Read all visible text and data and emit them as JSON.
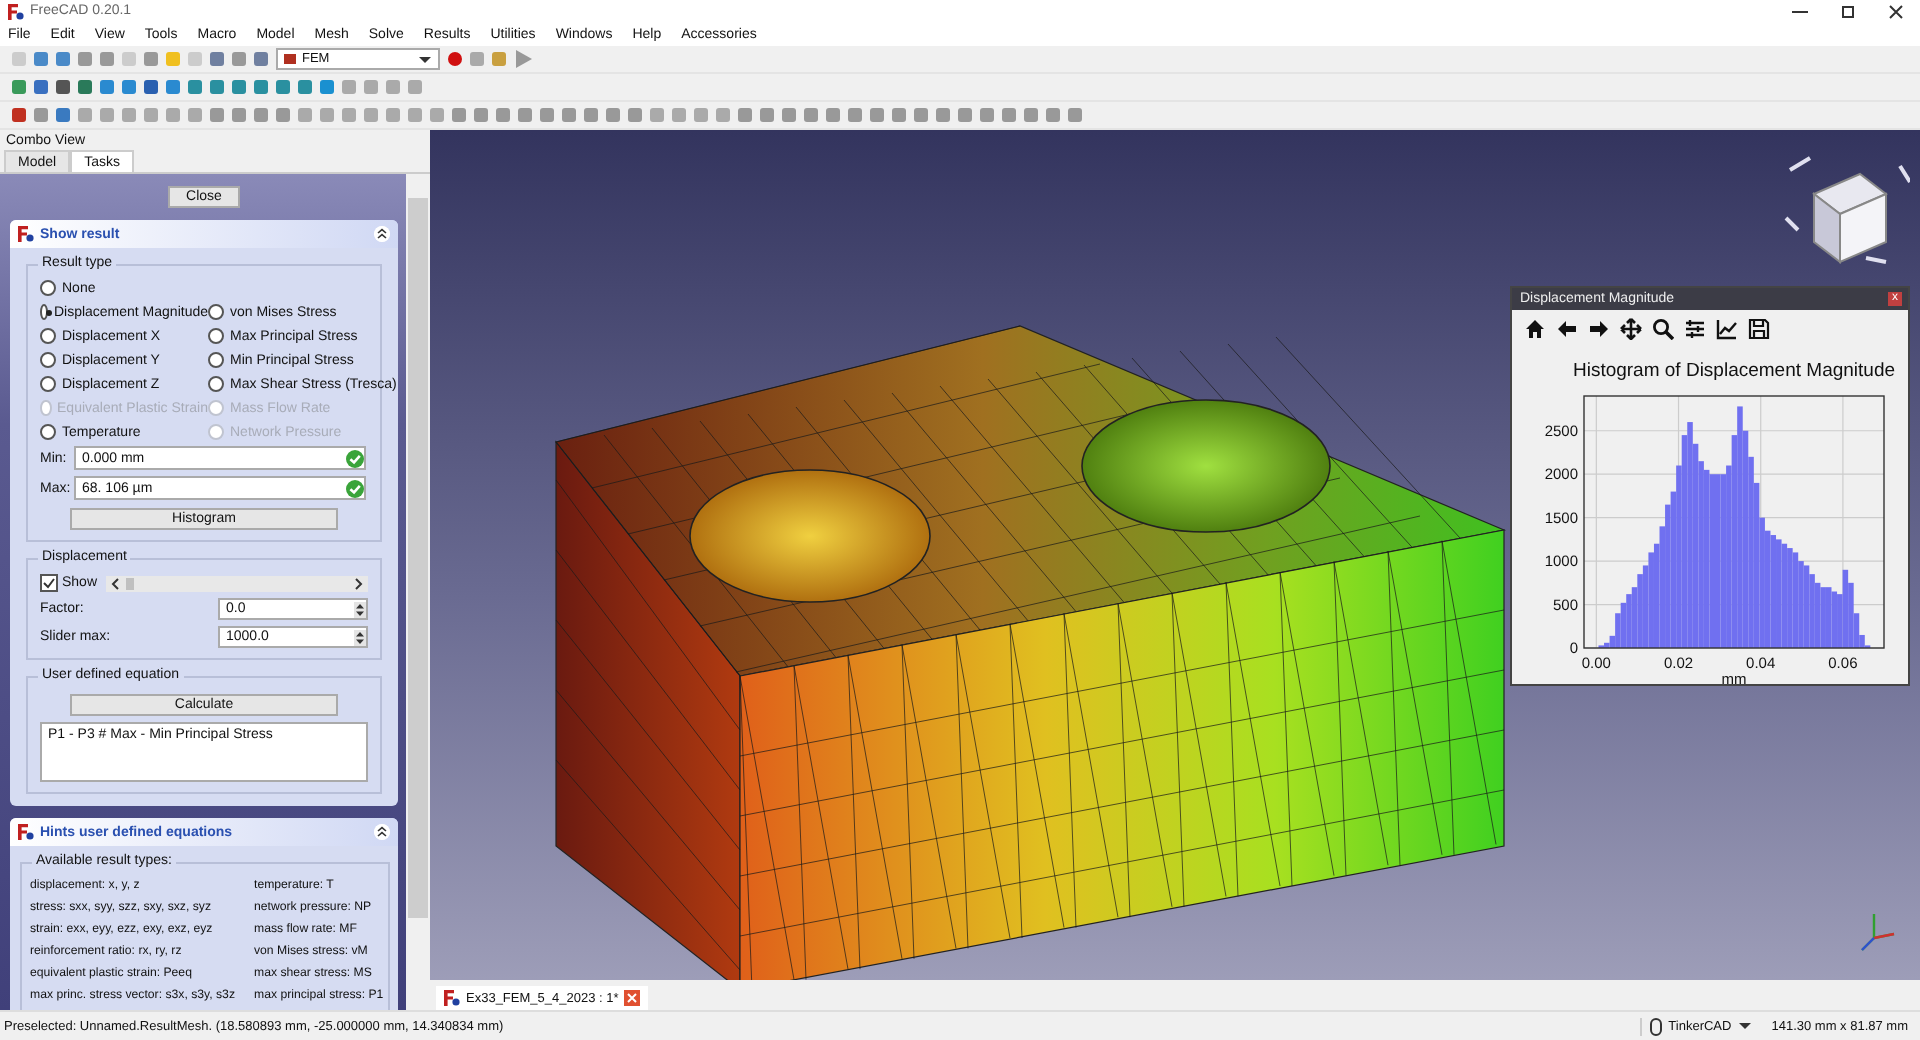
{
  "window": {
    "title": "FreeCAD 0.20.1"
  },
  "menu": [
    "File",
    "Edit",
    "View",
    "Tools",
    "Macro",
    "Model",
    "Mesh",
    "Solve",
    "Results",
    "Utilities",
    "Windows",
    "Help",
    "Accessories"
  ],
  "workbench": {
    "value": "FEM"
  },
  "combo_view": {
    "title": "Combo View",
    "tabs": [
      {
        "label": "Model",
        "selected": false
      },
      {
        "label": "Tasks",
        "selected": true
      }
    ],
    "close_button": "Close",
    "show_result": {
      "title": "Show result",
      "group": "Result type",
      "left_options": [
        {
          "label": "None",
          "selected": false,
          "disabled": false
        },
        {
          "label": "Displacement Magnitude",
          "selected": true,
          "disabled": false
        },
        {
          "label": "Displacement X",
          "selected": false,
          "disabled": false
        },
        {
          "label": "Displacement Y",
          "selected": false,
          "disabled": false
        },
        {
          "label": "Displacement Z",
          "selected": false,
          "disabled": false
        },
        {
          "label": "Equivalent Plastic Strain",
          "selected": false,
          "disabled": true
        },
        {
          "label": "Temperature",
          "selected": false,
          "disabled": false
        }
      ],
      "right_options": [
        {
          "label": "von Mises Stress",
          "selected": false,
          "disabled": false
        },
        {
          "label": "Max Principal Stress",
          "selected": false,
          "disabled": false
        },
        {
          "label": "Min Principal Stress",
          "selected": false,
          "disabled": false
        },
        {
          "label": "Max Shear Stress (Tresca)",
          "selected": false,
          "disabled": false
        },
        {
          "label": "Mass Flow Rate",
          "selected": false,
          "disabled": true
        },
        {
          "label": "Network Pressure",
          "selected": false,
          "disabled": true
        }
      ],
      "min": {
        "label": "Min:",
        "value": "0.000 mm"
      },
      "max": {
        "label": "Max:",
        "value": "68. 106 µm"
      },
      "histogram_button": "Histogram",
      "displacement": {
        "group": "Displacement",
        "show": {
          "label": "Show",
          "checked": true
        },
        "slider": {
          "level": 0.04
        },
        "factor": {
          "label": "Factor:",
          "value": "0.0"
        },
        "slider_max": {
          "label": "Slider max:",
          "value": "1000.0"
        }
      },
      "equation": {
        "group": "User defined equation",
        "calculate_button": "Calculate",
        "value": "P1 - P3 # Max - Min Principal Stress"
      }
    },
    "hints": {
      "title": "Hints user defined equations",
      "heading": "Available result types:",
      "rows": [
        [
          "displacement: x, y, z",
          "temperature: T"
        ],
        [
          "stress: sxx, syy, szz, sxy, sxz, syz",
          "network pressure: NP"
        ],
        [
          "strain: exx, eyy, ezz, exy, exz, eyz",
          "mass flow rate: MF"
        ],
        [
          "reinforcement ratio: rx, ry, rz",
          "von Mises stress: vM"
        ],
        [
          "equivalent plastic strain: Peeq",
          "max shear stress: MS"
        ],
        [
          "max princ. stress vector: s3x, s3y, s3z",
          "max principal stress: P1"
        ]
      ]
    }
  },
  "histogram_window": {
    "title": "Displacement Magnitude",
    "close": "x",
    "chart_data": {
      "type": "bar",
      "title": "Histogram of Displacement Magnitude",
      "xlabel": "mm",
      "xlim": [
        -0.003,
        0.07
      ],
      "ylim": [
        0,
        2900
      ],
      "xticks": [
        {
          "value": 0,
          "label": "0.00"
        },
        {
          "value": 0.02,
          "label": "0.02"
        },
        {
          "value": 0.04,
          "label": "0.04"
        },
        {
          "value": 0.06,
          "label": "0.06"
        }
      ],
      "yticks": [
        0,
        500,
        1000,
        1500,
        2000,
        2500
      ],
      "grid": true,
      "x": [
        0.0012,
        0.00255,
        0.0039,
        0.00525,
        0.0066,
        0.00795,
        0.0093,
        0.01065,
        0.012,
        0.01335,
        0.0147,
        0.01605,
        0.0174,
        0.01875,
        0.0201,
        0.02145,
        0.0228,
        0.02415,
        0.0255,
        0.02685,
        0.0282,
        0.02955,
        0.0309,
        0.03225,
        0.0336,
        0.03495,
        0.0363,
        0.03765,
        0.039,
        0.04035,
        0.0417,
        0.04305,
        0.0444,
        0.04575,
        0.0471,
        0.04845,
        0.0498,
        0.05115,
        0.0525,
        0.05385,
        0.0552,
        0.05655,
        0.0579,
        0.05925,
        0.0606,
        0.06195,
        0.0633,
        0.06465,
        0.066
      ],
      "series": [
        {
          "color": "#7070f0",
          "values": [
            30,
            60,
            140,
            400,
            520,
            620,
            700,
            850,
            950,
            1100,
            1200,
            1400,
            1650,
            1800,
            2100,
            2450,
            2600,
            2350,
            2150,
            2050,
            2000,
            2000,
            2000,
            2100,
            2450,
            2780,
            2500,
            2200,
            1900,
            1500,
            1350,
            1300,
            1250,
            1200,
            1150,
            1100,
            1000,
            950,
            850,
            750,
            700,
            700,
            650,
            620,
            900,
            750,
            400,
            150,
            30
          ]
        }
      ]
    }
  },
  "document_tab": {
    "label": "Ex33_FEM_5_4_2023 : 1*"
  },
  "status_bar": {
    "message": "Preselected: Unnamed.ResultMesh. (18.580893 mm, -25.000000 mm, 14.340834 mm)",
    "navigation": "TinkerCAD",
    "dimensions": "141.30 mm x 81.87 mm"
  }
}
